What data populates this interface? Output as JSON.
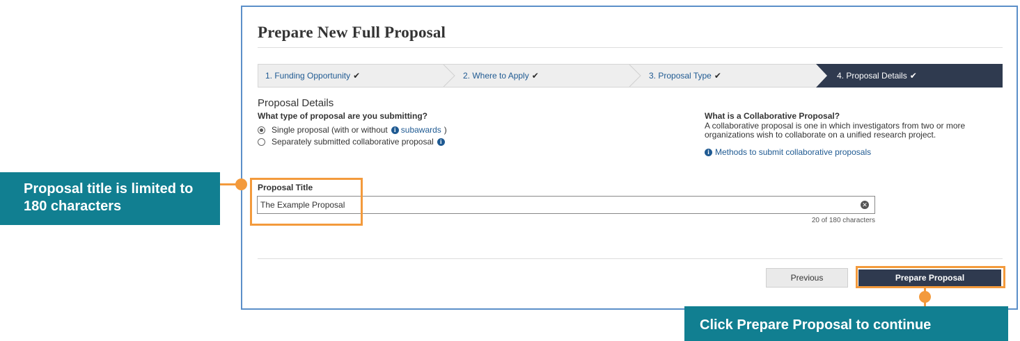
{
  "page": {
    "title": "Prepare New Full Proposal"
  },
  "stepper": {
    "steps": [
      {
        "label": "1. Funding Opportunity",
        "done": true
      },
      {
        "label": "2. Where to Apply",
        "done": true
      },
      {
        "label": "3. Proposal Type",
        "done": true
      },
      {
        "label": "4. Proposal Details",
        "done": true,
        "active": true
      }
    ],
    "check_glyph": "✔"
  },
  "details": {
    "heading": "Proposal Details",
    "question": "What type of proposal are you submitting?",
    "options": [
      {
        "label_before": "Single proposal (with or without",
        "link": "subawards",
        "label_after": ")",
        "selected": true
      },
      {
        "label": "Separately submitted collaborative proposal",
        "selected": false
      }
    ]
  },
  "collaborative": {
    "heading": "What is a Collaborative Proposal?",
    "text": "A collaborative proposal is one in which investigators from two or more organizations wish to collaborate on a unified research project.",
    "link": "Methods to submit collaborative proposals"
  },
  "title_field": {
    "label": "Proposal Title",
    "value": "The Example Proposal",
    "count_text": "20 of 180 characters"
  },
  "buttons": {
    "previous": "Previous",
    "prepare": "Prepare Proposal"
  },
  "callouts": {
    "title_limit": "Proposal title is limited to 180 characters",
    "prepare_hint": "Click Prepare Proposal to continue"
  },
  "icons": {
    "info": "info-icon",
    "clear": "clear-circle-icon"
  },
  "colors": {
    "accent_teal": "#117f91",
    "highlight_orange": "#f39a3c",
    "nav_dark": "#2f3a4f",
    "link_blue": "#1f5a92",
    "frame_blue": "#5b8fc9"
  }
}
